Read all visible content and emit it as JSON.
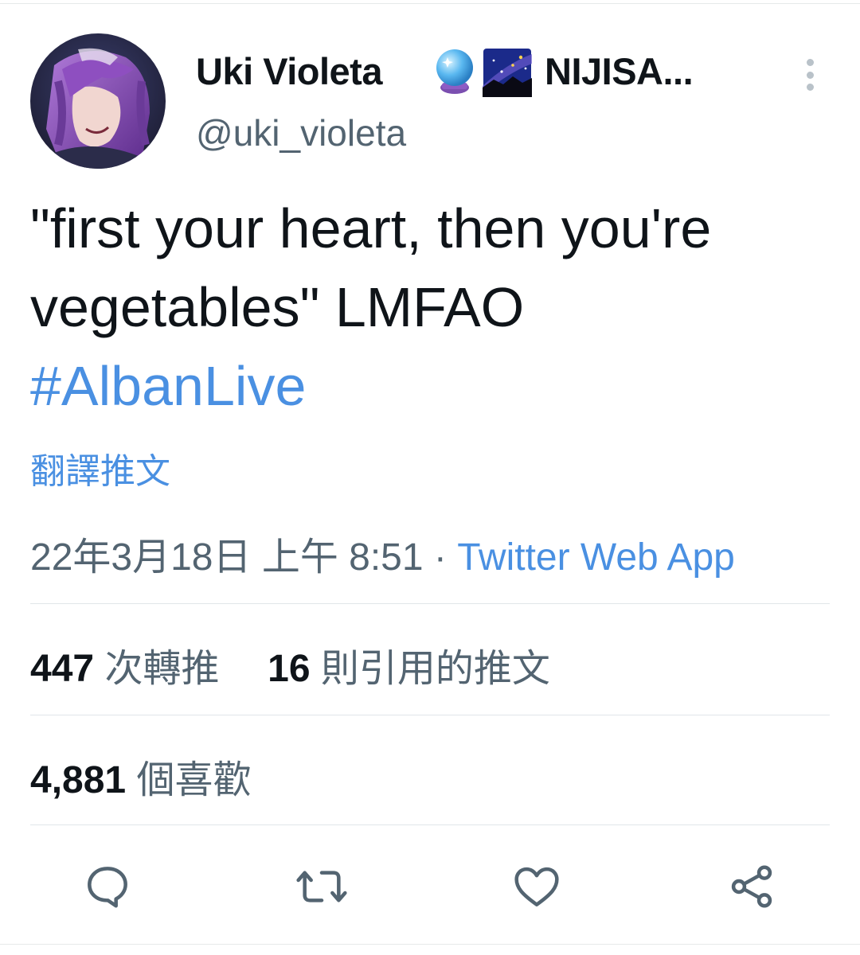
{
  "author": {
    "display_name": "Uki Violeta",
    "display_name_rest": "NIJISA...",
    "handle": "@uki_violeta",
    "emoji_1": "crystal-ball",
    "emoji_2": "milky-way"
  },
  "tweet": {
    "text_line_1": "\"first your heart, then you're",
    "text_line_2": "vegetables\" LMFAO",
    "hashtag": "#AlbanLive",
    "translate_label": "翻譯推文"
  },
  "meta": {
    "timestamp": "22年3月18日 上午 8:51",
    "separator": " · ",
    "source": "Twitter Web App"
  },
  "stats": {
    "retweets_count": "447",
    "retweets_label": "次轉推",
    "quotes_count": "16",
    "quotes_label": "則引用的推文",
    "likes_count": "4,881",
    "likes_label": "個喜歡"
  },
  "actions": {
    "reply": "reply-icon",
    "retweet": "retweet-icon",
    "like": "heart-icon",
    "share": "share-icon"
  },
  "colors": {
    "link": "#4a90e2",
    "text": "#0f1419",
    "secondary": "#536471",
    "icon": "#536471"
  }
}
